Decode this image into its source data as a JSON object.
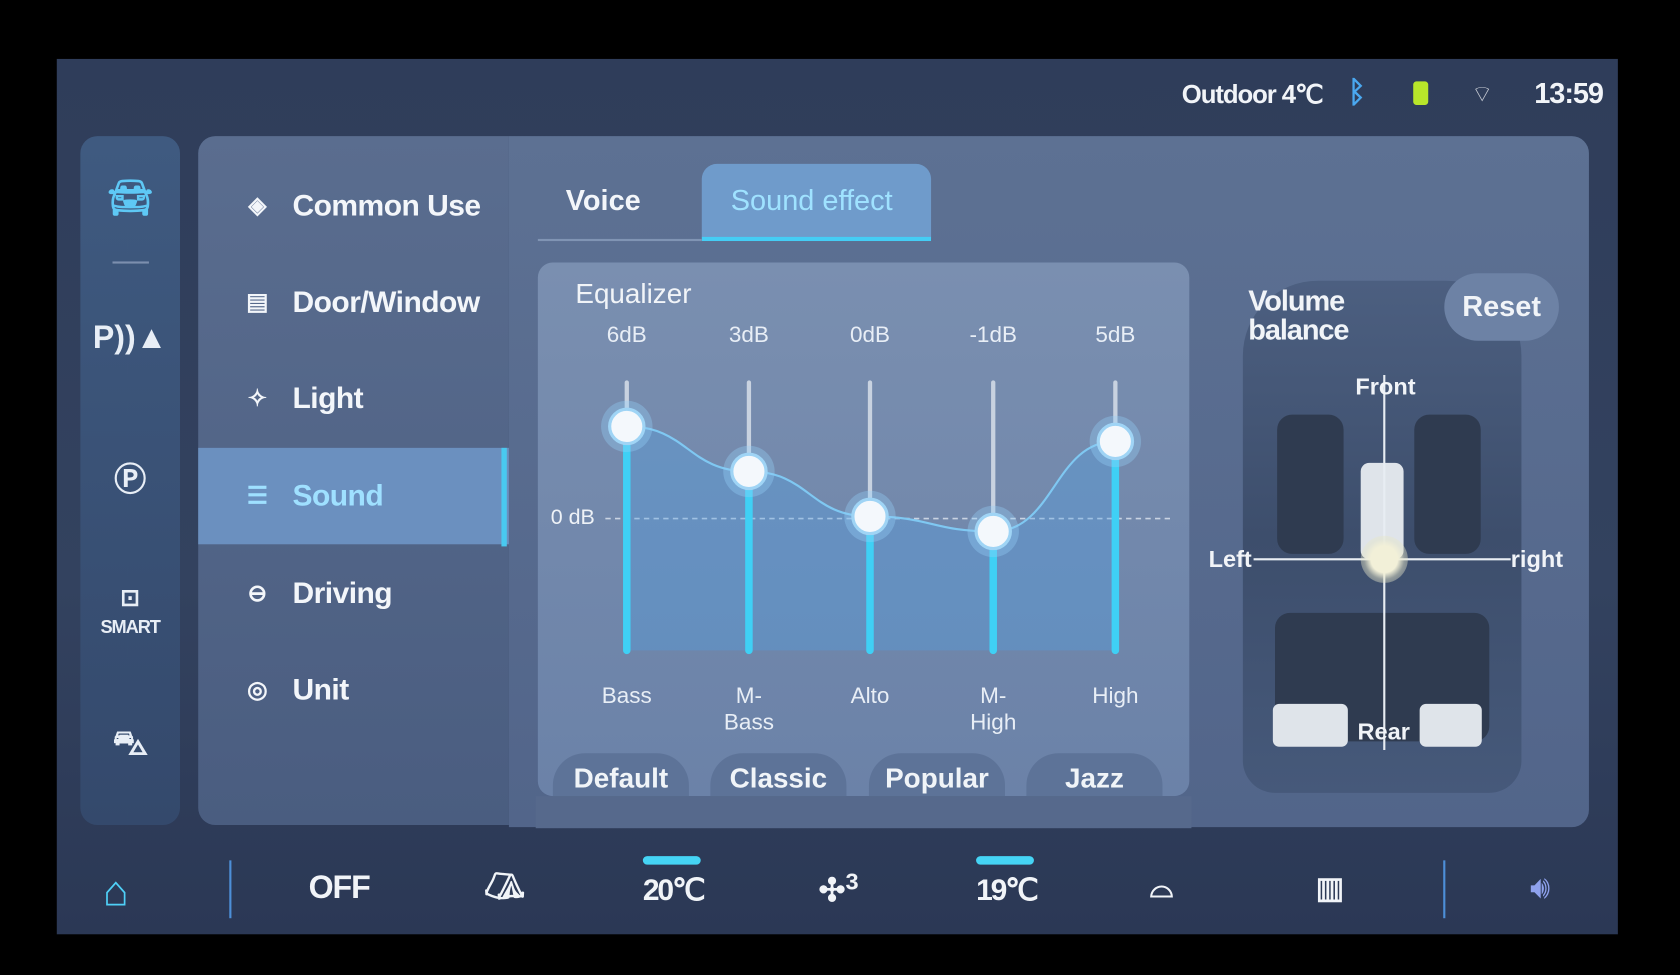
{
  "status_bar": {
    "outdoor_label": "Outdoor 4℃",
    "time": "13:59",
    "icons": [
      "bluetooth-icon",
      "battery-icon",
      "wifi-icon"
    ],
    "battery_color": "#b8e62a",
    "bluetooth_color": "#4aa8f0"
  },
  "rail": {
    "items": [
      {
        "icon": "car-icon",
        "active": true
      },
      {
        "icon": "parking-assist-icon",
        "label": "P"
      },
      {
        "icon": "auto-parking-icon",
        "label": "P"
      },
      {
        "icon": "smart-icon",
        "label": "SMART"
      },
      {
        "icon": "suv-icon"
      }
    ]
  },
  "menu": {
    "items": [
      {
        "label": "Common Use",
        "icon": "layers-icon"
      },
      {
        "label": "Door/Window",
        "icon": "door-icon"
      },
      {
        "label": "Light",
        "icon": "sparkle-icon"
      },
      {
        "label": "Sound",
        "icon": "sliders-icon",
        "selected": true
      },
      {
        "label": "Driving",
        "icon": "steering-wheel-icon"
      },
      {
        "label": "Unit",
        "icon": "gauge-icon"
      }
    ]
  },
  "tabs": [
    {
      "label": "Voice"
    },
    {
      "label": "Sound effect",
      "selected": true
    }
  ],
  "equalizer": {
    "title": "Equalizer",
    "zero_label": "0 dB",
    "bands": [
      {
        "name": "Bass",
        "value_label": "6dB",
        "value": 6
      },
      {
        "name": "M-\nBass",
        "value_label": "3dB",
        "value": 3
      },
      {
        "name": "Alto",
        "value_label": "0dB",
        "value": 0
      },
      {
        "name": "M-\nHigh",
        "value_label": "-1dB",
        "value": -1
      },
      {
        "name": "High",
        "value_label": "5dB",
        "value": 5
      }
    ],
    "presets": [
      "Default",
      "Classic",
      "Popular",
      "Jazz"
    ],
    "accent": "#3fd0f5"
  },
  "balance": {
    "title_line1": "Volume",
    "title_line2": "balance",
    "reset": "Reset",
    "front": "Front",
    "rear": "Rear",
    "left": "Left",
    "right": "right"
  },
  "bottom_bar": {
    "ac_status": "OFF",
    "left_temp": "20℃",
    "fan_level": "3",
    "right_temp": "19℃"
  }
}
